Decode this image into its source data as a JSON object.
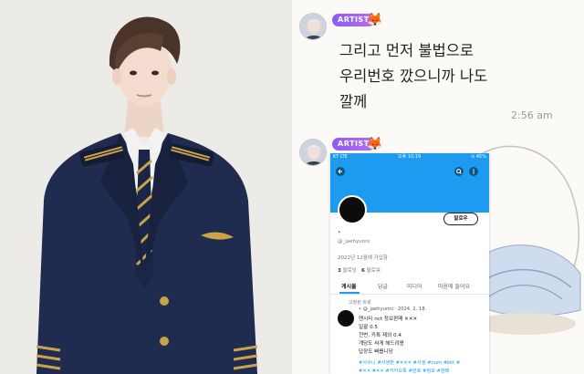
{
  "chat": {
    "messages": [
      {
        "badge": "ARTIST",
        "emoji": "🦊",
        "text": "그리고 먼저 불법으로 우리번호 깠으니까 나도 깔께",
        "time": "2:56 am"
      },
      {
        "badge": "ARTIST",
        "emoji": "🦊"
      }
    ]
  },
  "screenshot": {
    "status_left": "KT LTE",
    "status_time": "오후 10:19",
    "status_right": "⊙ 45%",
    "follow_label": "팔로우",
    "dot": "•",
    "handle": "@_jaehyunni",
    "joined": "2022년 12월에 가입함",
    "stats": {
      "following_count": "3",
      "following_label": "팔로잉",
      "followers_count": "6",
      "followers_label": "팔로워"
    },
    "tabs": [
      "게시물",
      "답글",
      "미디어",
      "마음에 들어요"
    ],
    "pinned": "고정된 트윗",
    "tweet": {
      "author": "• @_jaehyunni · 2024. 2. 18.",
      "lines": [
        "엔시티 nct 정보판매 ✕✕✕",
        "일괄 0.5",
        "전번, 카톡 제외 0.4",
        "개당도 싸게 해드려용",
        "답장도 빠릅니당"
      ],
      "tags1": "#사수니 #사생판 #✕✕✕ #사생 #num #kkt #",
      "tags2": "#✕✕ #✕✕ #카카오톡 #번호 #정보 #판매"
    }
  },
  "colors": {
    "badge_start": "#8b5cf6",
    "badge_end": "#b96cf0",
    "twitter_blue": "#1d9bf0",
    "uniform_navy": "#1f2b4f",
    "gold": "#c9a24a"
  }
}
